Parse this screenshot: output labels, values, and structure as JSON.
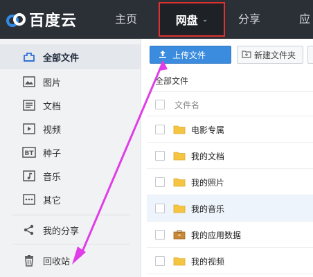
{
  "brand": {
    "name": "百度云"
  },
  "nav": {
    "home": "主页",
    "netdisk": "网盘",
    "share": "分享",
    "apps": "应"
  },
  "sidebar": {
    "items": [
      {
        "label": "全部文件",
        "icon": "all-files-icon"
      },
      {
        "label": "图片",
        "icon": "image-icon"
      },
      {
        "label": "文档",
        "icon": "document-icon"
      },
      {
        "label": "视频",
        "icon": "video-icon"
      },
      {
        "label": "种子",
        "icon": "bt-icon"
      },
      {
        "label": "音乐",
        "icon": "music-icon"
      },
      {
        "label": "其它",
        "icon": "other-icon"
      },
      {
        "label": "我的分享",
        "icon": "share-icon"
      },
      {
        "label": "回收站",
        "icon": "trash-icon"
      }
    ]
  },
  "toolbar": {
    "upload": "上传文件",
    "new_folder": "新建文件夹"
  },
  "breadcrumb": "全部文件",
  "list": {
    "header": "文件名",
    "rows": [
      {
        "name": "电影专属",
        "type": "folder"
      },
      {
        "name": "我的文档",
        "type": "folder"
      },
      {
        "name": "我的照片",
        "type": "folder"
      },
      {
        "name": "我的音乐",
        "type": "folder"
      },
      {
        "name": "我的应用数据",
        "type": "app-folder"
      },
      {
        "name": "我的视频",
        "type": "folder"
      }
    ]
  },
  "colors": {
    "topbar": "#2b2f36",
    "accent": "#3b8cde",
    "highlight_border": "#e03131",
    "annotation_arrow": "#e03ce8",
    "folder": "#f5c542"
  }
}
